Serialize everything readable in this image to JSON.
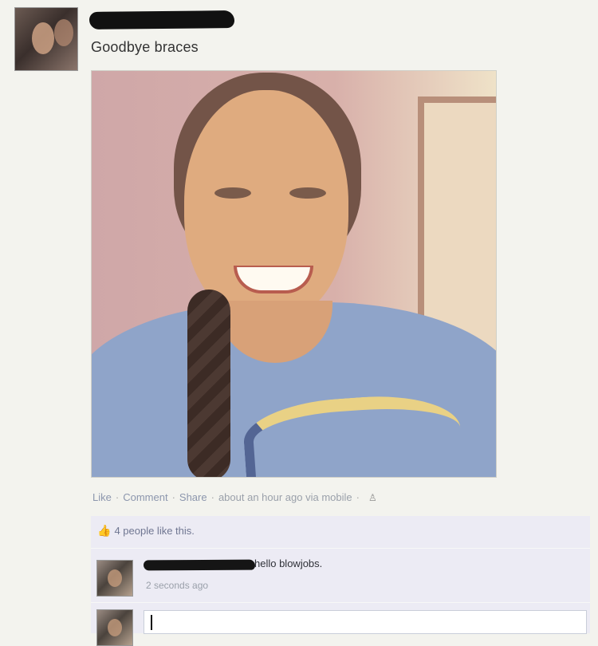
{
  "post": {
    "status": "Goodbye braces"
  },
  "actions": {
    "like": "Like",
    "comment": "Comment",
    "share": "Share",
    "timestamp": "about an hour ago via mobile",
    "audience_icon": "people-icon"
  },
  "likes": {
    "text": "4 people like this."
  },
  "comment": {
    "text": "hello blowjobs.",
    "time": "2 seconds ago"
  },
  "reply": {
    "placeholder": ""
  }
}
